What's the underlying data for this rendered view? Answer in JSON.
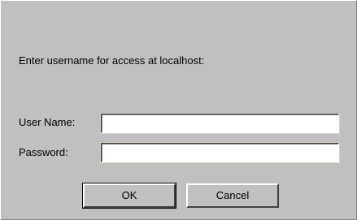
{
  "dialog": {
    "prompt": "Enter username for access at localhost:",
    "username": {
      "label": "User Name:",
      "value": ""
    },
    "password": {
      "label": "Password:",
      "value": ""
    },
    "buttons": {
      "ok": "OK",
      "cancel": "Cancel"
    }
  }
}
